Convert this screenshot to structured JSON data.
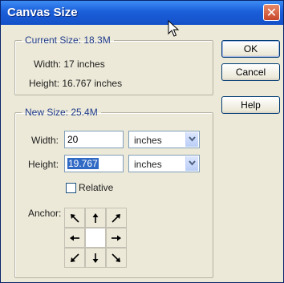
{
  "window": {
    "title": "Canvas Size",
    "close_glyph": "✕"
  },
  "current_size": {
    "legend": "Current Size: 18.3M",
    "width_text": "Width: 17 inches",
    "height_text": "Height: 16.767 inches"
  },
  "new_size": {
    "legend": "New Size: 25.4M",
    "width_label": "Width:",
    "width_value": "20",
    "width_unit": "inches",
    "height_label": "Height:",
    "height_value": "19.767",
    "height_unit": "inches",
    "relative_label": "Relative",
    "relative_checked": false,
    "anchor_label": "Anchor:",
    "anchor_cells": [
      "arrow-up-left-icon",
      "arrow-up-icon",
      "arrow-up-right-icon",
      "arrow-left-icon",
      "anchor-center",
      "arrow-right-icon",
      "arrow-down-left-icon",
      "arrow-down-icon",
      "arrow-down-right-icon"
    ]
  },
  "buttons": {
    "ok": "OK",
    "cancel": "Cancel",
    "help": "Help"
  },
  "colors": {
    "titlebar": "#1b5fd9",
    "close": "#c7452a",
    "selection": "#316ac5",
    "legend": "#1f3b8b"
  }
}
